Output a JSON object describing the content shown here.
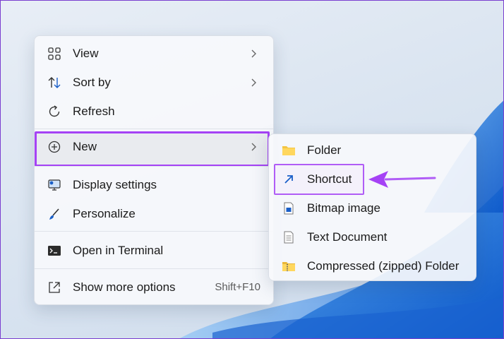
{
  "context_menu": {
    "items": [
      {
        "label": "View",
        "icon": "grid-icon",
        "submenu": true
      },
      {
        "label": "Sort by",
        "icon": "sort-arrows-icon",
        "submenu": true
      },
      {
        "label": "Refresh",
        "icon": "refresh-icon"
      },
      {
        "label": "New",
        "icon": "plus-circle-icon",
        "submenu": true,
        "highlighted": true
      },
      {
        "label": "Display settings",
        "icon": "display-settings-icon"
      },
      {
        "label": "Personalize",
        "icon": "brush-icon"
      },
      {
        "label": "Open in Terminal",
        "icon": "terminal-icon"
      },
      {
        "label": "Show more options",
        "icon": "share-arrow-icon",
        "shortcut": "Shift+F10"
      }
    ]
  },
  "new_submenu": {
    "items": [
      {
        "label": "Folder",
        "icon": "folder-icon"
      },
      {
        "label": "Shortcut",
        "icon": "shortcut-icon",
        "highlighted": true
      },
      {
        "label": "Bitmap image",
        "icon": "bitmap-icon"
      },
      {
        "label": "Text Document",
        "icon": "text-document-icon"
      },
      {
        "label": "Compressed (zipped) Folder",
        "icon": "zip-folder-icon"
      }
    ]
  },
  "colors": {
    "highlight_border": "#a542f5",
    "annotation_arrow": "#b05df6",
    "folder": "#f4c542"
  }
}
